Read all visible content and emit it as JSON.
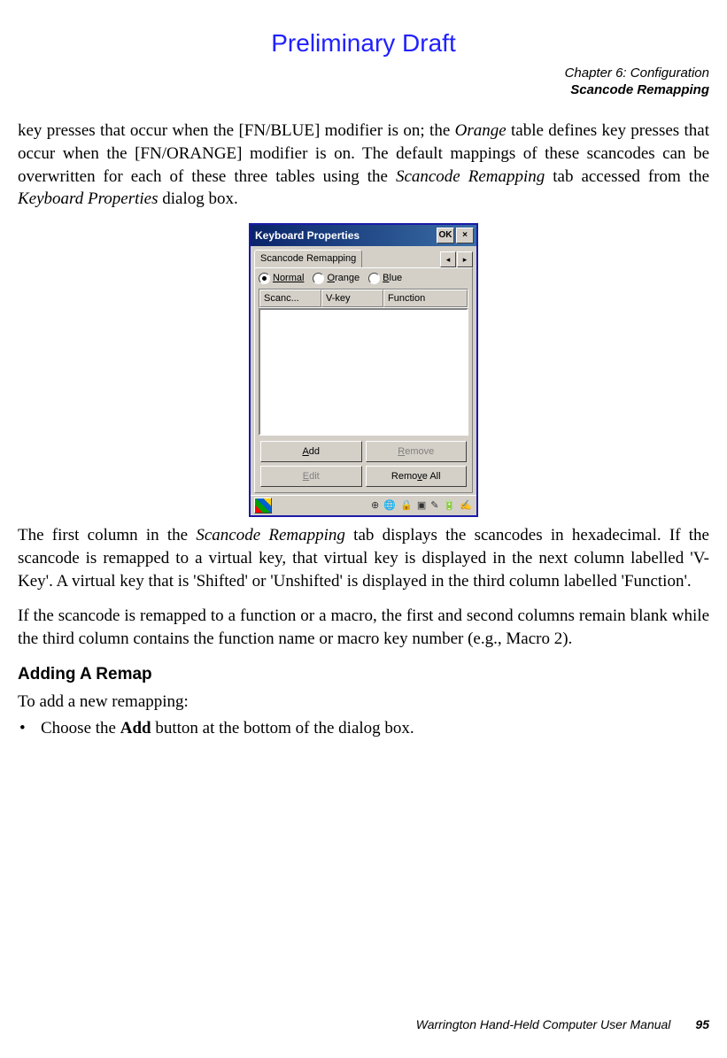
{
  "draft_label": "Preliminary Draft",
  "chapter": {
    "line1": "Chapter 6: Configuration",
    "line2": "Scancode Remapping"
  },
  "paragraphs": {
    "p1_a": "key presses that occur when the [FN/BLUE] modifier is on; the ",
    "p1_b": "Orange",
    "p1_c": " table defines key presses that occur when the [FN/ORANGE] modifier is on. The default mappings of these scancodes can be overwritten for each of these three tables using the ",
    "p1_d": "Scancode Remapping",
    "p1_e": " tab accessed from the ",
    "p1_f": "Keyboard Properties",
    "p1_g": " dialog box.",
    "p2_a": "The first column in the ",
    "p2_b": "Scancode Remapping",
    "p2_c": " tab displays the scancodes in hexadecimal. If the scancode is remapped to a virtual key, that virtual key is displayed in the next column labelled 'V-Key'. A virtual key that is 'Shifted' or 'Unshifted' is displayed in the third column labelled 'Function'.",
    "p3": "If the scancode is remapped to a function or a macro, the first and second columns remain blank while the third column contains the function name or macro key number (e.g., Macro 2).",
    "heading": "Adding A Remap",
    "p4": "To add a new remapping:",
    "bullet_a": "Choose the ",
    "bullet_b": "Add",
    "bullet_c": " button at the bottom of the dialog box."
  },
  "dialog": {
    "title": "Keyboard Properties",
    "ok": "OK",
    "close": "×",
    "tab": "Scancode Remapping",
    "left_arrow": "◂",
    "right_arrow": "▸",
    "radios": {
      "normal": "Normal",
      "orange": "Orange",
      "blue": "Blue"
    },
    "columns": {
      "c1": "Scanc...",
      "c2": "V-key",
      "c3": "Function"
    },
    "buttons": {
      "add_u": "A",
      "add_rest": "dd",
      "remove_u": "R",
      "remove_rest": "emove",
      "edit_u": "E",
      "edit_rest": "dit",
      "removeall_u": "v",
      "removeall_pre": "Remo",
      "removeall_post": "e All"
    },
    "tray_icons": "⊕ 🌐 🔒 ▣ ✎ 🔋 ✍"
  },
  "footer": {
    "manual": "Warrington Hand-Held Computer User Manual",
    "page": "95"
  }
}
